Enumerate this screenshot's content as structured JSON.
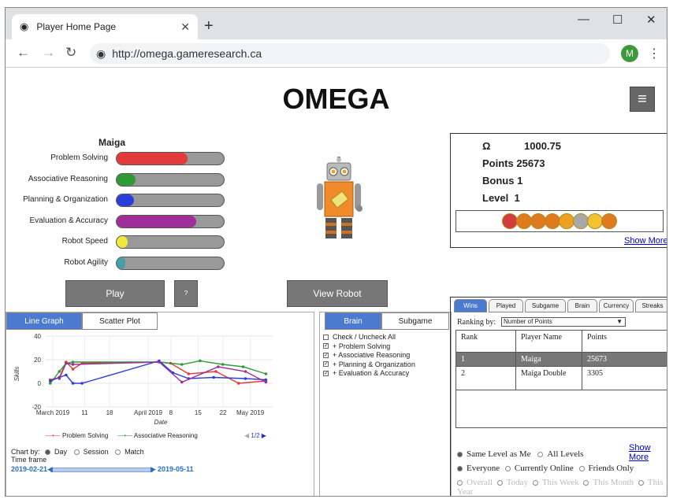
{
  "browser": {
    "tab_title": "Player Home Page",
    "url": "http://omega.gameresearch.ca",
    "profile_initial": "M"
  },
  "page": {
    "brand": "OMEGA",
    "menu_icon": "hamburger-icon"
  },
  "player": {
    "name": "Maiga",
    "skills": [
      {
        "label": "Problem Solving",
        "level": 0.66,
        "color": "#e33b3b"
      },
      {
        "label": "Associative Reasoning",
        "level": 0.18,
        "color": "#2e9a36"
      },
      {
        "label": "Planning & Organization",
        "level": 0.16,
        "color": "#2b3ddb"
      },
      {
        "label": "Evaluation & Accuracy",
        "level": 0.74,
        "color": "#a02e9a"
      },
      {
        "label": "Robot Speed",
        "level": 0.1,
        "color": "#f0e83a"
      },
      {
        "label": "Robot Agility",
        "level": 0.08,
        "color": "#43a0a8"
      }
    ]
  },
  "buttons": {
    "play": "Play",
    "help": "?",
    "view_robot": "View Robot"
  },
  "stats": {
    "omega_symbol": "Ω",
    "omega_value": "1000.75",
    "points_label": "Points",
    "points_value": "25673",
    "bonus_label": "Bonus",
    "bonus_value": "1",
    "level_label": "Level",
    "level_value": "1",
    "badge_colors": [
      "#d23d3d",
      "#e07b1d",
      "#e07b1d",
      "#e07b1d",
      "#f0a020",
      "#a8a8a8",
      "#f2c230",
      "#e07b1d"
    ],
    "show_more": "Show More"
  },
  "chart_tabs": {
    "line": "Line Graph",
    "scatter": "Scatter Plot"
  },
  "chart_data": {
    "type": "line",
    "ylabel": "Skills",
    "xlabel": "Date",
    "ylim": [
      -20,
      40
    ],
    "yticks": [
      "40",
      "20",
      "0",
      "-20"
    ],
    "xticks": [
      "March 2019",
      "11",
      "18",
      "April 2019",
      "8",
      "15",
      "22",
      "May 2019"
    ],
    "series": [
      {
        "name": "Problem Solving",
        "color": "#e33b3b",
        "values": [
          [
            0.02,
            3
          ],
          [
            0.06,
            5
          ],
          [
            0.09,
            18
          ],
          [
            0.12,
            12
          ],
          [
            0.16,
            17
          ],
          [
            0.5,
            18
          ],
          [
            0.55,
            17
          ],
          [
            0.63,
            8
          ],
          [
            0.75,
            10
          ],
          [
            0.85,
            0
          ],
          [
            0.97,
            2
          ]
        ]
      },
      {
        "name": "Associative Reasoning",
        "color": "#2e9a36",
        "values": [
          [
            0.02,
            0
          ],
          [
            0.06,
            10
          ],
          [
            0.09,
            17
          ],
          [
            0.12,
            18
          ],
          [
            0.5,
            18
          ],
          [
            0.6,
            16
          ],
          [
            0.68,
            19
          ],
          [
            0.78,
            16
          ],
          [
            0.87,
            14
          ],
          [
            0.97,
            8
          ]
        ]
      },
      {
        "name": "",
        "color": "#2b3ddb",
        "values": [
          [
            0.02,
            2
          ],
          [
            0.06,
            5
          ],
          [
            0.09,
            7
          ],
          [
            0.12,
            0
          ],
          [
            0.16,
            0
          ],
          [
            0.5,
            19
          ],
          [
            0.56,
            9
          ],
          [
            0.63,
            4
          ],
          [
            0.74,
            5
          ],
          [
            0.88,
            4
          ],
          [
            0.97,
            3
          ]
        ]
      },
      {
        "name": "",
        "color": "#a02e9a",
        "values": [
          [
            0.06,
            4
          ],
          [
            0.09,
            17
          ],
          [
            0.12,
            16
          ],
          [
            0.5,
            18
          ],
          [
            0.6,
            1
          ],
          [
            0.76,
            14
          ],
          [
            0.88,
            10
          ],
          [
            0.97,
            1
          ]
        ]
      }
    ],
    "legend": [
      "Problem Solving",
      "Associative Reasoning"
    ],
    "legend_page": "1/2"
  },
  "chart_options": {
    "chart_by": "Chart by:",
    "day": "Day",
    "session": "Session",
    "match": "Match",
    "time_frame": "Time frame",
    "start_date": "2019-02-21",
    "end_date": "2019-05-11"
  },
  "brain_tabs": {
    "brain": "Brain",
    "subgame": "Subgame"
  },
  "checklist": [
    {
      "label": "Check / Uncheck All",
      "checked": false
    },
    {
      "label": "+ Problem Solving",
      "checked": true
    },
    {
      "label": "+ Associative Reasoning",
      "checked": true
    },
    {
      "label": "+ Planning & Organization",
      "checked": true
    },
    {
      "label": "+ Evaluation & Accuracy",
      "checked": true
    }
  ],
  "rank": {
    "tabs": [
      "Wins",
      "Played",
      "Subgame",
      "Brain",
      "Currency",
      "Streaks"
    ],
    "ranking_by_label": "Ranking by:",
    "ranking_by_value": "Number of Points",
    "headers": [
      "Rank",
      "Player Name",
      "Points"
    ],
    "rows": [
      [
        "1",
        "Maiga",
        "25673"
      ],
      [
        "2",
        "Maiga Double",
        "3305"
      ]
    ],
    "show_more": "Show More",
    "filter1": [
      "Same Level as Me",
      "All Levels"
    ],
    "filter2": [
      "Everyone",
      "Currently Online",
      "Friends Only"
    ],
    "filter3": [
      "Overall",
      "Today",
      "This Week",
      "This Month",
      "This Year"
    ]
  }
}
